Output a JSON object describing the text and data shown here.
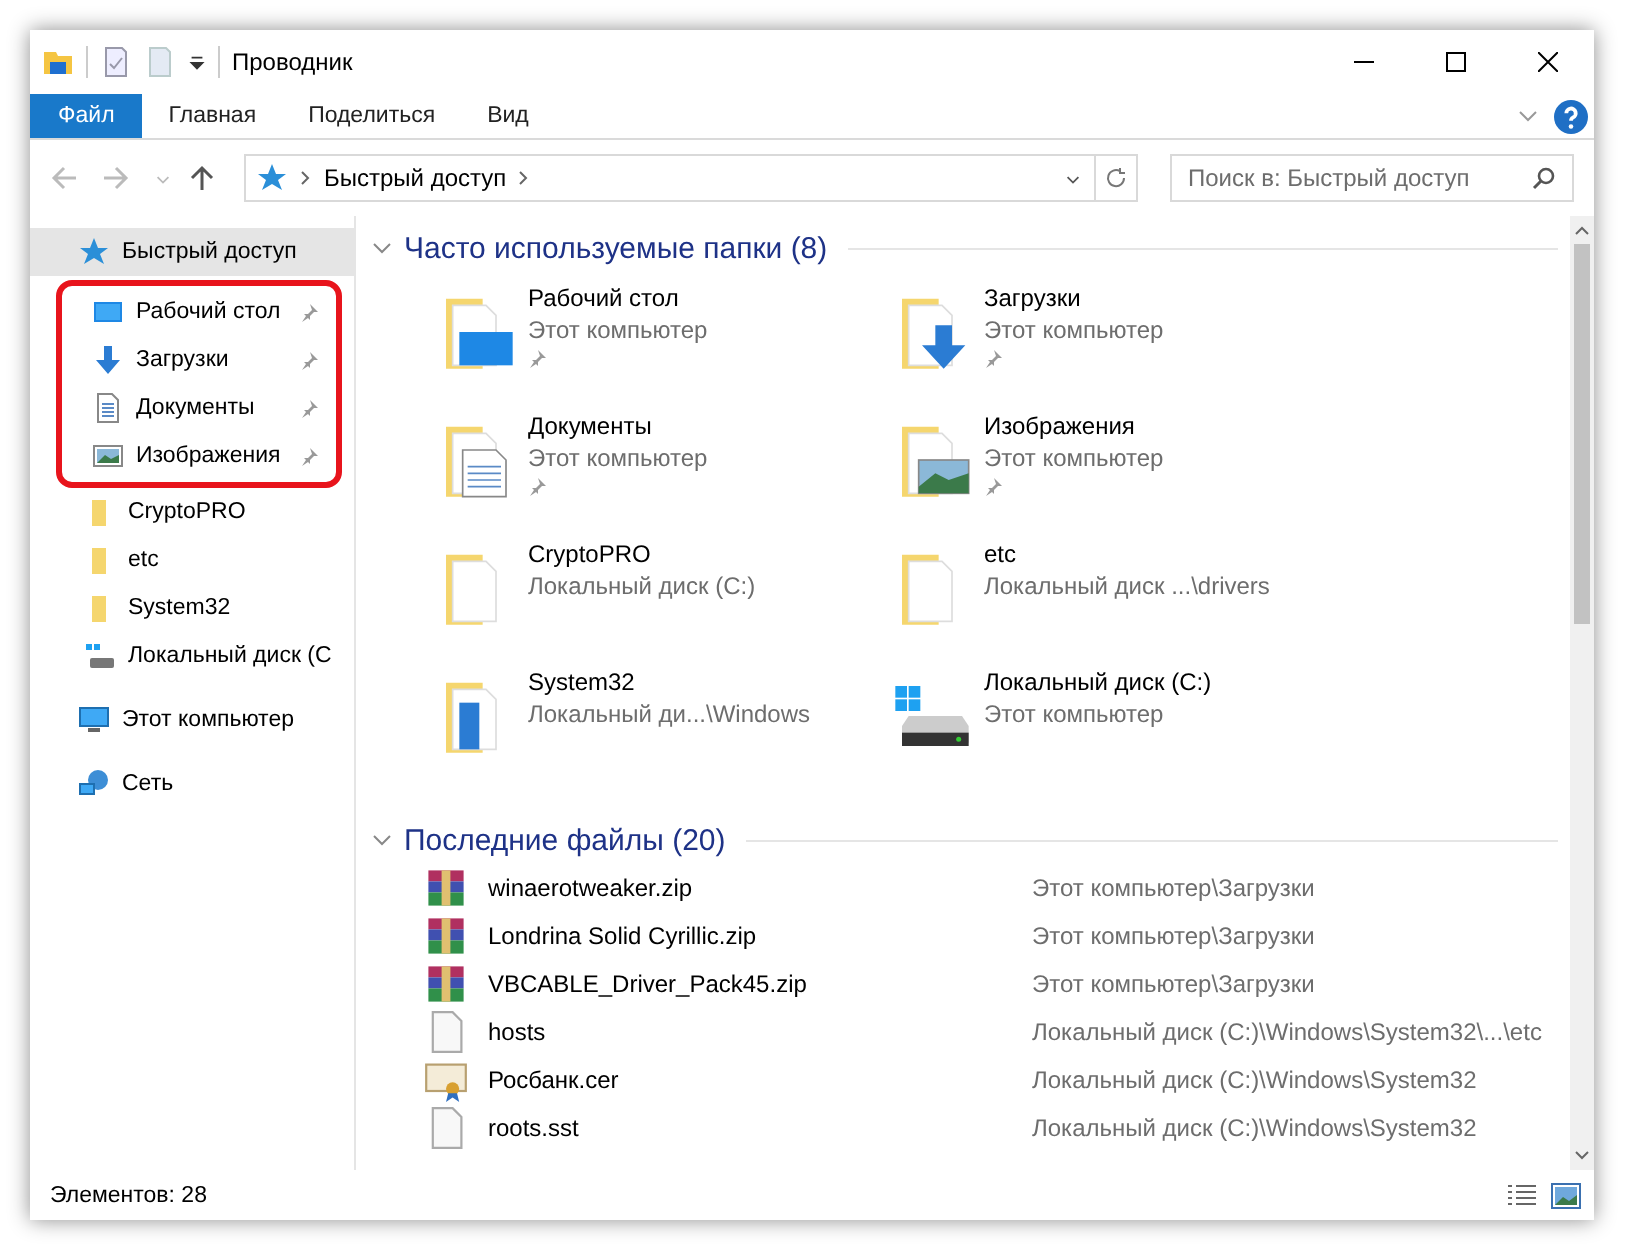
{
  "window": {
    "title": "Проводник"
  },
  "ribbon": {
    "tabs": [
      {
        "label": "Файл",
        "selected": true
      },
      {
        "label": "Главная",
        "selected": false
      },
      {
        "label": "Поделиться",
        "selected": false
      },
      {
        "label": "Вид",
        "selected": false
      }
    ]
  },
  "address_bar": {
    "path": [
      "Быстрый доступ"
    ]
  },
  "search": {
    "placeholder": "Поиск в: Быстрый доступ"
  },
  "sidebar": {
    "items": [
      {
        "label": "Быстрый доступ",
        "kind": "star",
        "selected": true,
        "children": [
          {
            "label": "Рабочий стол",
            "kind": "desktop",
            "pinned": true
          },
          {
            "label": "Загрузки",
            "kind": "downloads",
            "pinned": true
          },
          {
            "label": "Документы",
            "kind": "documents",
            "pinned": true
          },
          {
            "label": "Изображения",
            "kind": "pictures",
            "pinned": true
          },
          {
            "label": "CryptoPRO",
            "kind": "folder",
            "pinned": false
          },
          {
            "label": "etc",
            "kind": "folder",
            "pinned": false
          },
          {
            "label": "System32",
            "kind": "folder",
            "pinned": false
          },
          {
            "label": "Локальный диск (С",
            "kind": "drive",
            "pinned": false
          }
        ]
      },
      {
        "label": "Этот компьютер",
        "kind": "computer",
        "selected": false
      },
      {
        "label": "Сеть",
        "kind": "network",
        "selected": false
      }
    ]
  },
  "frequent_folders": {
    "title": "Часто используемые папки (8)",
    "expanded": true,
    "items": [
      {
        "name": "Рабочий стол",
        "location": "Этот компьютер",
        "pinned": true,
        "kind": "desktop"
      },
      {
        "name": "Загрузки",
        "location": "Этот компьютер",
        "pinned": true,
        "kind": "downloads"
      },
      {
        "name": "Документы",
        "location": "Этот компьютер",
        "pinned": true,
        "kind": "documents"
      },
      {
        "name": "Изображения",
        "location": "Этот компьютер",
        "pinned": true,
        "kind": "pictures"
      },
      {
        "name": "CryptoPRO",
        "location": "Локальный диск (C:)",
        "pinned": false,
        "kind": "folder"
      },
      {
        "name": "etc",
        "location": "Локальный диск ...\\drivers",
        "pinned": false,
        "kind": "folder"
      },
      {
        "name": "System32",
        "location": "Локальный ди...\\Windows",
        "pinned": false,
        "kind": "system"
      },
      {
        "name": "Локальный диск (C:)",
        "location": "Этот компьютер",
        "pinned": false,
        "kind": "drive"
      }
    ]
  },
  "recent_files": {
    "title": "Последние файлы (20)",
    "expanded": true,
    "items": [
      {
        "name": "winaerotweaker.zip",
        "location": "Этот компьютер\\Загрузки",
        "kind": "archive"
      },
      {
        "name": "Londrina Solid Cyrillic.zip",
        "location": "Этот компьютер\\Загрузки",
        "kind": "archive"
      },
      {
        "name": "VBCABLE_Driver_Pack45.zip",
        "location": "Этот компьютер\\Загрузки",
        "kind": "archive"
      },
      {
        "name": "hosts",
        "location": "Локальный диск (C:)\\Windows\\System32\\...\\etc",
        "kind": "file"
      },
      {
        "name": "Росбанк.cer",
        "location": "Локальный диск (C:)\\Windows\\System32",
        "kind": "certificate"
      },
      {
        "name": "roots.sst",
        "location": "Локальный диск (C:)\\Windows\\System32",
        "kind": "file"
      }
    ]
  },
  "status_bar": {
    "text": "Элементов: 28"
  }
}
